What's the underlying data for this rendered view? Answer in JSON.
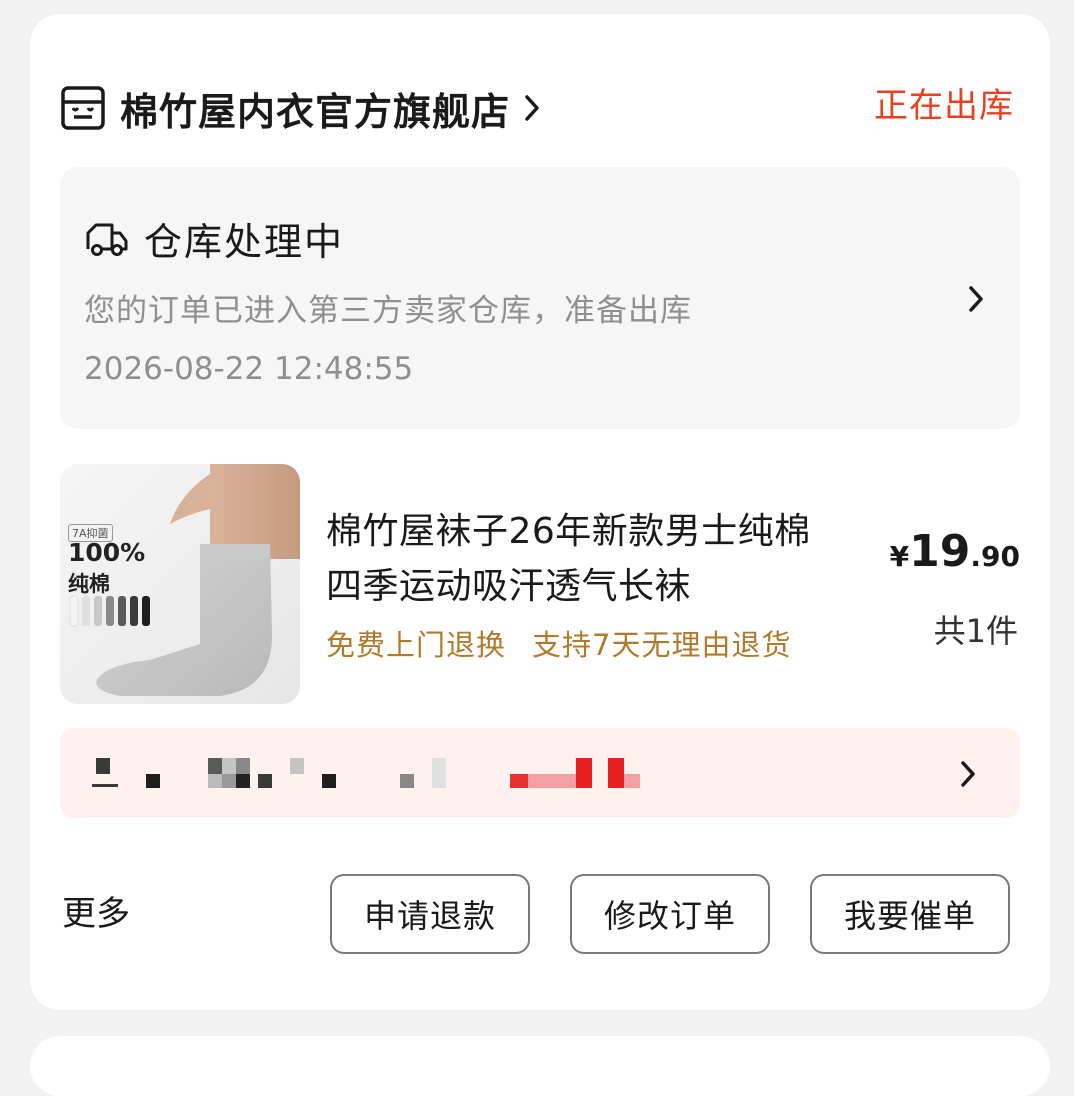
{
  "order": {
    "store_name": "棉竹屋内衣官方旗舰店",
    "status": "正在出库",
    "warehouse": {
      "title": "仓库处理中",
      "description": "您的订单已进入第三方卖家仓库，准备出库",
      "timestamp": "2026-08-22 12:48:55"
    },
    "product": {
      "title": "棉竹屋袜子26年新款男士纯棉四季运动吸汗透气长袜",
      "tags": [
        "免费上门退换",
        "支持7天无理由退货"
      ],
      "price_currency": "¥",
      "price_integer": "19",
      "price_decimal": ".90",
      "quantity": "共1件",
      "image_text": {
        "badge": "7A抑菌",
        "percent": "100%",
        "material": "纯棉"
      }
    },
    "footer": {
      "more_label": "更多",
      "buttons": [
        "申请退款",
        "修改订单",
        "我要催单"
      ]
    }
  },
  "colors": {
    "status": "#e8411f",
    "tag": "#b07a2b",
    "promo_bg": "#fff1f0"
  }
}
